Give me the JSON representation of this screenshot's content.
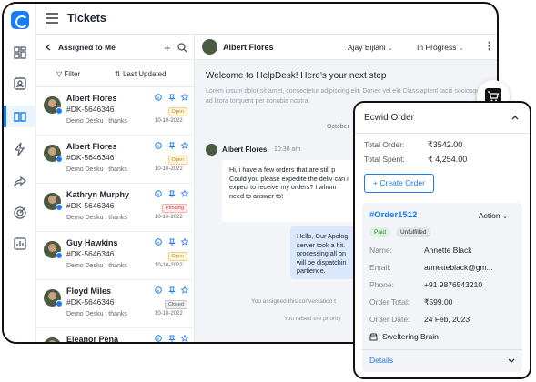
{
  "header": {
    "title": "Tickets"
  },
  "list": {
    "heading": "Assigned to Me",
    "filter_label": "Filter",
    "sort_label": "Last Updated",
    "tickets": [
      {
        "name": "Albert Flores",
        "id": "#DK-5646346",
        "preview": "Demo Desku : thanks",
        "date": "10-10-2022",
        "status": "Open"
      },
      {
        "name": "Albert Flores",
        "id": "#DK-5646346",
        "preview": "Demo Desku : thanks",
        "date": "10-10-2022",
        "status": "Open"
      },
      {
        "name": "Kathryn Murphy",
        "id": "#DK-5646346",
        "preview": "Demo Desku : thanks",
        "date": "10-10-2022",
        "status": "Pending"
      },
      {
        "name": "Guy Hawkins",
        "id": "#DK-5646346",
        "preview": "Demo Desku : thanks",
        "date": "10-10-2022",
        "status": "Open"
      },
      {
        "name": "Floyd Miles",
        "id": "#DK-5646346",
        "preview": "Demo Desku : thanks",
        "date": "10-10-2022",
        "status": "Closed"
      },
      {
        "name": "Eleanor Pena",
        "id": "",
        "preview": "",
        "date": "",
        "status": ""
      }
    ]
  },
  "conversation": {
    "customer_name": "Albert Flores",
    "agent": "Ajay Bijlani",
    "state": "In Progress",
    "welcome": "Welcome to HelpDesk! Here's your next step",
    "lorem": "Lorem ipsum dolor sit amet, consectetur adipiscing elit. Donec vel elit Class aptent taciti sociosqu ad litora torquent per conubia nostra.",
    "day_separator": "October",
    "message": {
      "author": "Albert Flores",
      "time": "10:30 am",
      "text": "Hi, i have a few orders that are still p Could you please expedite the deliv can i expect to receive my orders? I whom i need to answer to!"
    },
    "reply": "Hello, Our Apolog server took a hit. processing all on will be dispatchin partience.",
    "system_1": "You assigned this conversation t",
    "system_2": "You raised the priority"
  },
  "ecwid": {
    "title": "Ecwid Order",
    "total_order_label": "Total Order:",
    "total_order_value": "₹3542.00",
    "total_spent_label": "Total Spent:",
    "total_spent_value": "₹ 4,254.00",
    "create_button": "+ Create Order",
    "order": {
      "id": "#Order1512",
      "action_label": "Action",
      "tag_paid": "Paid",
      "tag_unfulfilled": "Unfulfilled",
      "fields": [
        {
          "label": "Name:",
          "value": "Annette Black"
        },
        {
          "label": "Email:",
          "value": "annetteblack@gm..."
        },
        {
          "label": "Phone:",
          "value": "+91 9876543210"
        },
        {
          "label": "Order Total:",
          "value": "₹599.00"
        },
        {
          "label": "Order Date:",
          "value": "24 Feb, 2023"
        }
      ],
      "store": "Sweltering Brain",
      "details_label": "Details"
    }
  },
  "colors": {
    "accent": "#1a7cf2",
    "background": "#f3f4f7"
  }
}
